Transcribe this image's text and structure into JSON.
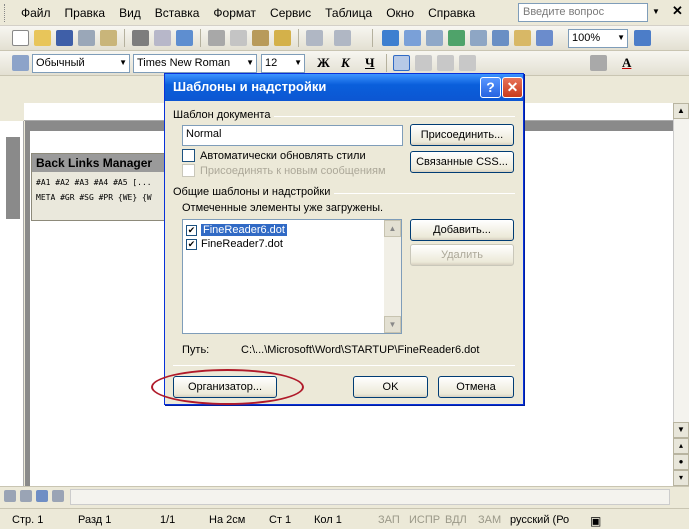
{
  "menu": {
    "items": [
      "Файл",
      "Правка",
      "Вид",
      "Вставка",
      "Формат",
      "Сервис",
      "Таблица",
      "Окно",
      "Справка"
    ],
    "help_placeholder": "Введите вопрос"
  },
  "toolbar": {
    "zoom": "100%",
    "style": "Обычный",
    "font": "Times New Roman",
    "size": "12",
    "bold": "Ж",
    "italic": "К",
    "underline": "Ч",
    "font_color_letter": "A"
  },
  "blm": {
    "title": "Back Links Manager",
    "row1": "#A1 #A2 #A3 #A4 #A5 [...",
    "row2": "META #GR #SG #PR {WE} {W"
  },
  "dialog": {
    "title": "Шаблоны и надстройки",
    "group_template": "Шаблон документа",
    "template_value": "Normal",
    "attach_button": "Присоединить...",
    "css_button": "Связанные CSS...",
    "auto_update": "Автоматически обновлять стили",
    "attach_new_messages": "Присоединять к новым сообщениям",
    "group_addins": "Общие шаблоны и надстройки",
    "loaded_note": "Отмеченные элементы уже загружены.",
    "list": [
      {
        "name": "FineReader6.dot",
        "checked": true,
        "selected": true
      },
      {
        "name": "FineReader7.dot",
        "checked": true,
        "selected": false
      }
    ],
    "add_button": "Добавить...",
    "remove_button": "Удалить",
    "path_label": "Путь:",
    "path_value": "C:\\...\\Microsoft\\Word\\STARTUP\\FineReader6.dot",
    "organizer_button": "Организатор...",
    "ok_button": "OK",
    "cancel_button": "Отмена"
  },
  "status": {
    "page": "Стр. 1",
    "section": "Разд 1",
    "pages": "1/1",
    "at": "На 2см",
    "line": "Ст 1",
    "col": "Кол 1",
    "rec": "ЗАП",
    "trk": "ИСПР",
    "ext": "ВДЛ",
    "ovr": "ЗАМ",
    "language": "русский (Ро"
  },
  "colors": {
    "titlebar": "#0a5fdb",
    "selection": "#316ac5",
    "highlight_ellipse": "#b01a2a"
  }
}
